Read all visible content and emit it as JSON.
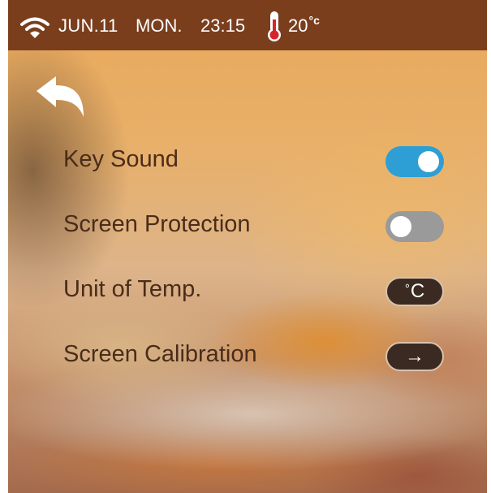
{
  "status_bar": {
    "date": "JUN.11",
    "day": "MON.",
    "time": "23:15",
    "temperature_value": "20",
    "temperature_unit": "°c",
    "icons": [
      "wifi-icon",
      "thermometer-icon"
    ]
  },
  "navigation": {
    "back_icon": "back-arrow-icon"
  },
  "settings": [
    {
      "label": "Key Sound",
      "control": "toggle",
      "state": "on"
    },
    {
      "label": "Screen Protection",
      "control": "toggle",
      "state": "off"
    },
    {
      "label": "Unit of Temp.",
      "control": "unit-button",
      "value_degree": "°",
      "value_unit": "C"
    },
    {
      "label": "Screen Calibration",
      "control": "arrow-button",
      "value": "→"
    }
  ],
  "colors": {
    "status_bar": "#7a3e1d",
    "toggle_on": "#2d9fd4",
    "toggle_off": "#9a9a9a",
    "label_text": "#4a2c1a",
    "button_bg": "#3b2a22"
  }
}
